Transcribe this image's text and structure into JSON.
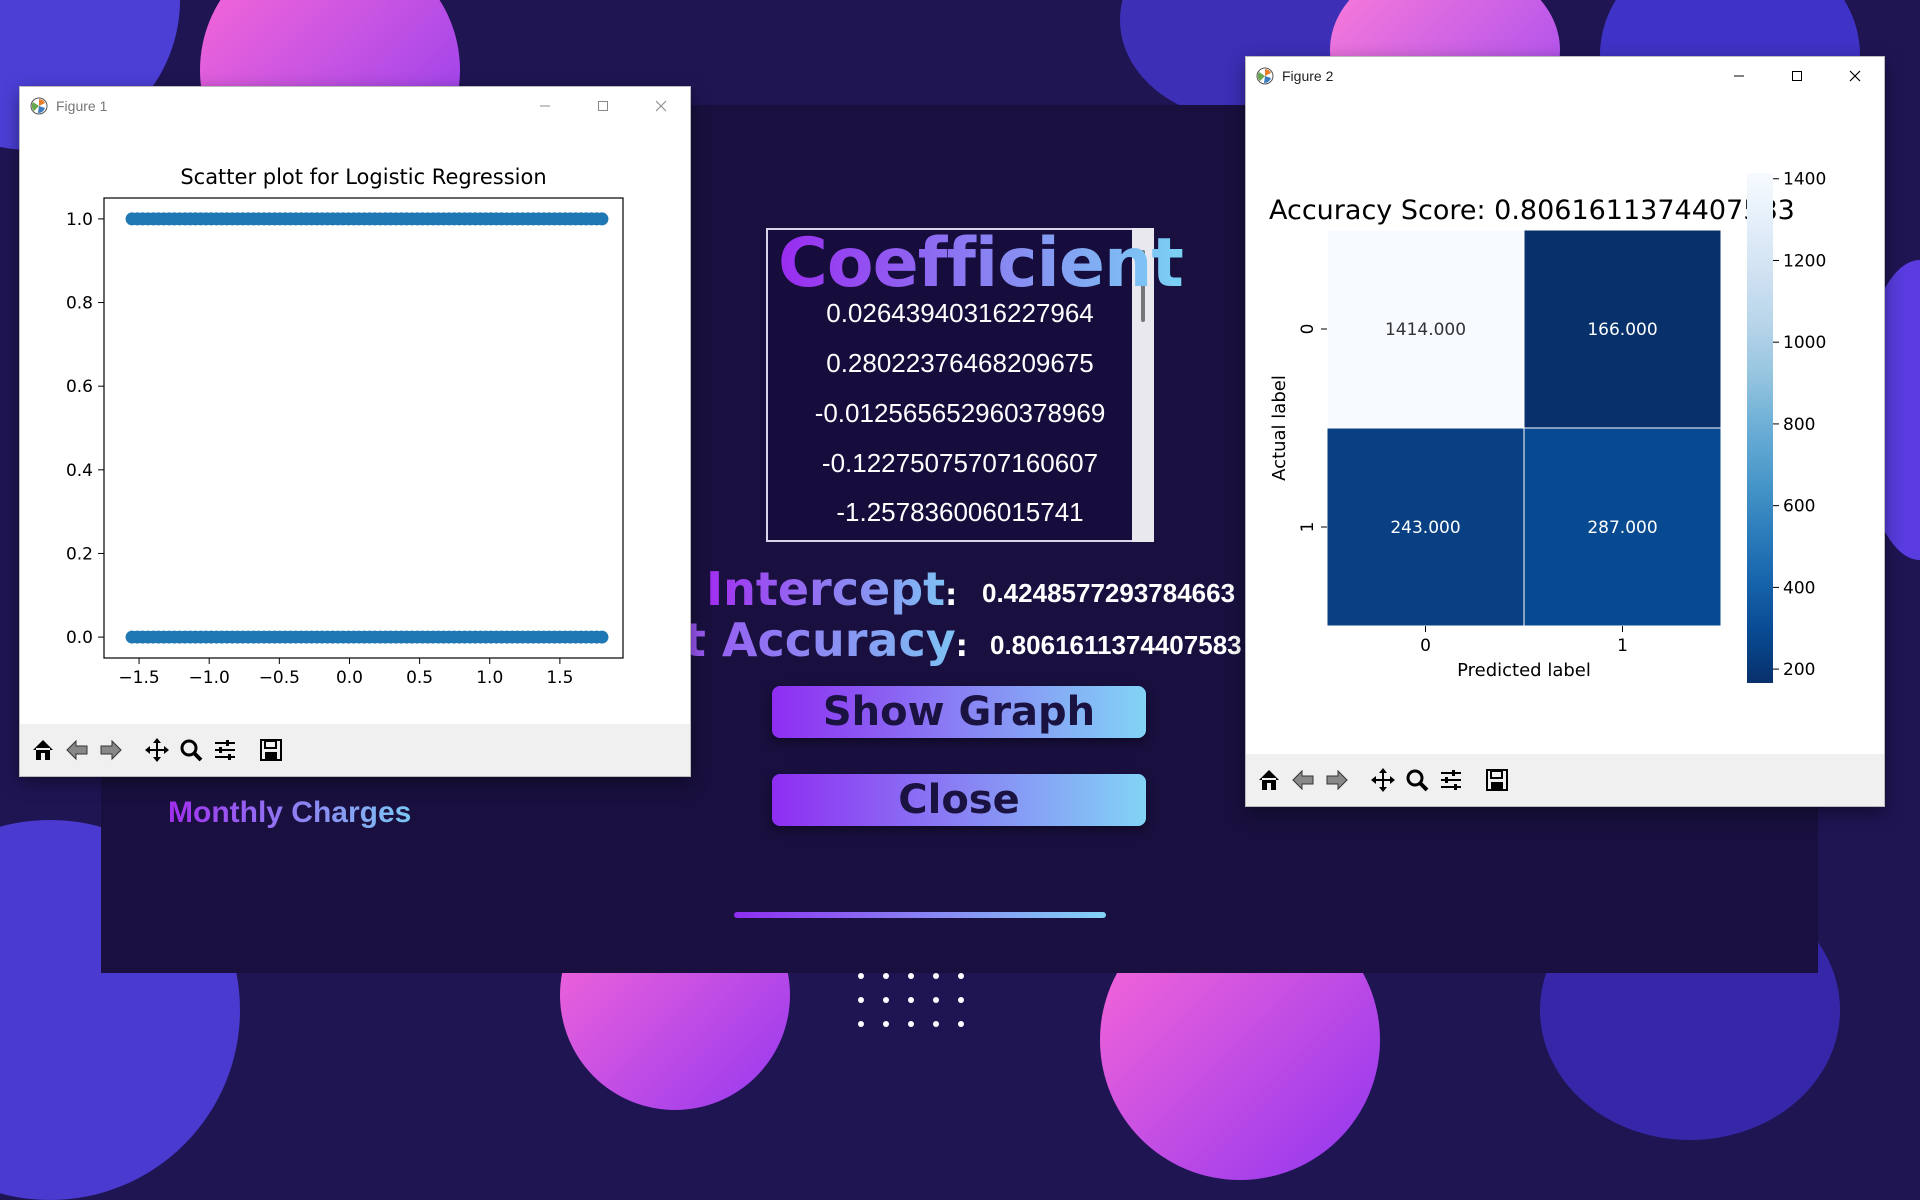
{
  "figure1": {
    "window_title": "Figure 1",
    "chart_data": {
      "type": "scatter",
      "title": "Scatter plot for Logistic Regression",
      "xlabel": "",
      "ylabel": "",
      "xlim": [
        -1.75,
        1.95
      ],
      "ylim": [
        -0.05,
        1.05
      ],
      "x_ticks": [
        -1.5,
        -1.0,
        -0.5,
        0.0,
        0.5,
        1.0,
        1.5
      ],
      "x_tick_labels": [
        "−1.5",
        "−1.0",
        "−0.5",
        "0.0",
        "0.5",
        "1.0",
        "1.5"
      ],
      "y_ticks": [
        0.0,
        0.2,
        0.4,
        0.6,
        0.8,
        1.0
      ],
      "y_tick_labels": [
        "0.0",
        "0.2",
        "0.4",
        "0.6",
        "0.8",
        "1.0"
      ],
      "series": [
        {
          "color": "#1f77b4",
          "y": 1.0,
          "x_range": [
            -1.55,
            1.8
          ]
        },
        {
          "color": "#1f77b4",
          "y": 0.0,
          "x_range": [
            -1.55,
            1.8
          ]
        }
      ]
    },
    "below_label": "Monthly Charges"
  },
  "figure2": {
    "window_title": "Figure 2",
    "chart_data": {
      "type": "heatmap",
      "title": "Accuracy Score: 0.8061611374407583",
      "xlabel": "Predicted label",
      "ylabel": "Actual label",
      "x_categories": [
        "0",
        "1"
      ],
      "y_categories": [
        "0",
        "1"
      ],
      "values": [
        [
          1414,
          166
        ],
        [
          243,
          287
        ]
      ],
      "value_labels": [
        [
          "1414.000",
          "166.000"
        ],
        [
          "243.000",
          "287.000"
        ]
      ],
      "colorbar_range": [
        166,
        1414
      ],
      "colorbar_ticks": [
        "1400",
        "1200",
        "1000",
        "800",
        "600",
        "400",
        "200"
      ],
      "colormap": "Blues"
    }
  },
  "coefficient": {
    "title": "Coefficient",
    "values": [
      "0.02643940316227964",
      "0.28022376468209675",
      "-0.012565652960378969",
      "-0.12275075707160607",
      "-1.257836006015741"
    ]
  },
  "intercept": {
    "label": "Intercept",
    "colon": ":",
    "value": "0.4248577293784663"
  },
  "test_accuracy": {
    "label": "Test Accuracy",
    "colon": ":",
    "value": "0.8061611374407583"
  },
  "buttons": {
    "show_graph": "Show Graph",
    "close": "Close"
  },
  "colors": {
    "accent_purple": "#9a2bf0",
    "accent_cyan": "#7ad2f4",
    "background": "#1f1553"
  }
}
